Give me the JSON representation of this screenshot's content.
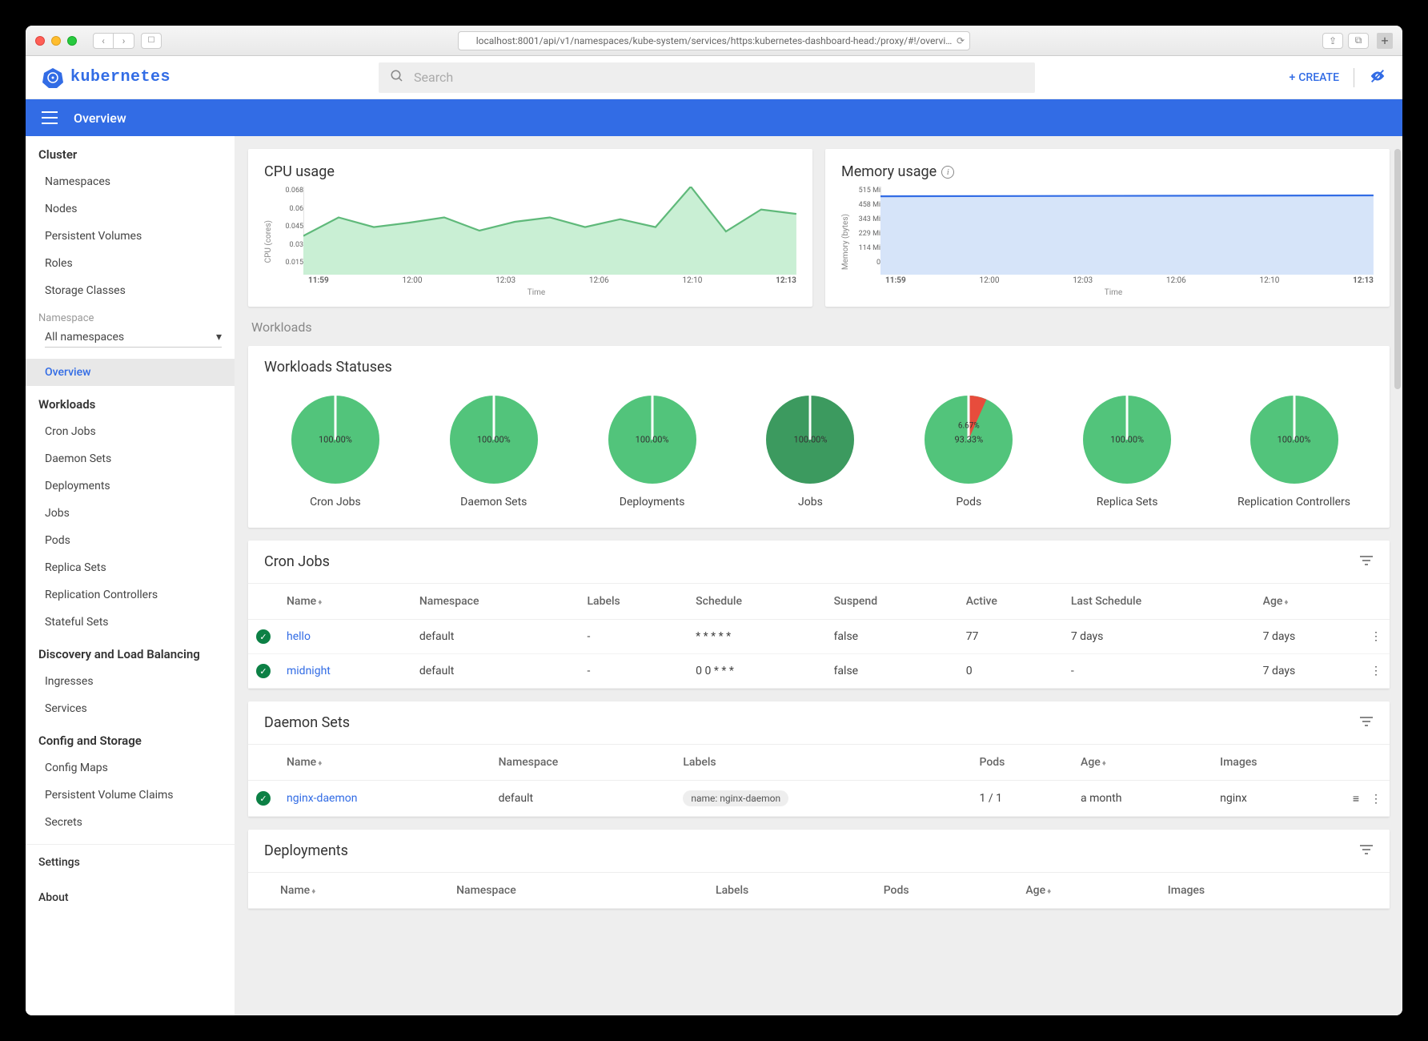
{
  "browser": {
    "url": "localhost:8001/api/v1/namespaces/kube-system/services/https:kubernetes-dashboard-head:/proxy/#!/overvi…"
  },
  "header": {
    "logo_text": "kubernetes",
    "search_placeholder": "Search",
    "create_label": "CREATE"
  },
  "bluebar": {
    "title": "Overview"
  },
  "sidebar": {
    "cluster_title": "Cluster",
    "cluster_items": [
      "Namespaces",
      "Nodes",
      "Persistent Volumes",
      "Roles",
      "Storage Classes"
    ],
    "namespace_label": "Namespace",
    "namespace_value": "All namespaces",
    "overview": "Overview",
    "workloads_title": "Workloads",
    "workloads_items": [
      "Cron Jobs",
      "Daemon Sets",
      "Deployments",
      "Jobs",
      "Pods",
      "Replica Sets",
      "Replication Controllers",
      "Stateful Sets"
    ],
    "discovery_title": "Discovery and Load Balancing",
    "discovery_items": [
      "Ingresses",
      "Services"
    ],
    "config_title": "Config and Storage",
    "config_items": [
      "Config Maps",
      "Persistent Volume Claims",
      "Secrets"
    ],
    "settings": "Settings",
    "about": "About"
  },
  "workloads_label": "Workloads",
  "cpu_chart": {
    "title": "CPU usage",
    "ylabel": "CPU (cores)",
    "xlabel": "Time"
  },
  "mem_chart": {
    "title": "Memory usage",
    "ylabel": "Memory (bytes)",
    "xlabel": "Time"
  },
  "workloads_statuses": {
    "title": "Workloads Statuses",
    "items": [
      {
        "name": "Cron Jobs",
        "pct": "100.00%",
        "green": 100,
        "red": 0,
        "dark": false
      },
      {
        "name": "Daemon Sets",
        "pct": "100.00%",
        "green": 100,
        "red": 0,
        "dark": false
      },
      {
        "name": "Deployments",
        "pct": "100.00%",
        "green": 100,
        "red": 0,
        "dark": false
      },
      {
        "name": "Jobs",
        "pct": "100.00%",
        "green": 100,
        "red": 0,
        "dark": true
      },
      {
        "name": "Pods",
        "pct": "93.33%",
        "pct2": "6.67%",
        "green": 93.33,
        "red": 6.67,
        "dark": false
      },
      {
        "name": "Replica Sets",
        "pct": "100.00%",
        "green": 100,
        "red": 0,
        "dark": false
      },
      {
        "name": "Replication Controllers",
        "pct": "100.00%",
        "green": 100,
        "red": 0,
        "dark": false
      }
    ]
  },
  "cronjobs": {
    "title": "Cron Jobs",
    "columns": [
      "Name",
      "Namespace",
      "Labels",
      "Schedule",
      "Suspend",
      "Active",
      "Last Schedule",
      "Age"
    ],
    "rows": [
      {
        "name": "hello",
        "ns": "default",
        "labels": "-",
        "schedule": "* * * * *",
        "suspend": "false",
        "active": "77",
        "last": "7 days",
        "age": "7 days"
      },
      {
        "name": "midnight",
        "ns": "default",
        "labels": "-",
        "schedule": "0 0 * * *",
        "suspend": "false",
        "active": "0",
        "last": "-",
        "age": "7 days"
      }
    ]
  },
  "daemonsets": {
    "title": "Daemon Sets",
    "columns": [
      "Name",
      "Namespace",
      "Labels",
      "Pods",
      "Age",
      "Images"
    ],
    "rows": [
      {
        "name": "nginx-daemon",
        "ns": "default",
        "labels": "name: nginx-daemon",
        "pods": "1 / 1",
        "age": "a month",
        "images": "nginx"
      }
    ]
  },
  "deployments": {
    "title": "Deployments",
    "columns": [
      "Name",
      "Namespace",
      "Labels",
      "Pods",
      "Age",
      "Images"
    ]
  },
  "chart_data": [
    {
      "type": "area",
      "title": "CPU usage",
      "xlabel": "Time",
      "ylabel": "CPU (cores)",
      "y_ticks": [
        0.068,
        0.06,
        0.045,
        0.03,
        0.015
      ],
      "x_ticks": [
        "11:59",
        "12:00",
        "12:03",
        "12:06",
        "12:10",
        "12:13"
      ],
      "ylim": [
        0,
        0.068
      ],
      "series": [
        {
          "name": "cpu",
          "color": "#5fb97a",
          "x": [
            "11:59",
            "12:00",
            "12:01",
            "12:02",
            "12:03",
            "12:04",
            "12:05",
            "12:06",
            "12:07",
            "12:08",
            "12:09",
            "12:10",
            "12:11",
            "12:12",
            "12:13"
          ],
          "values": [
            0.03,
            0.044,
            0.037,
            0.04,
            0.044,
            0.034,
            0.041,
            0.044,
            0.037,
            0.043,
            0.037,
            0.068,
            0.033,
            0.05,
            0.047
          ]
        }
      ]
    },
    {
      "type": "area",
      "title": "Memory usage",
      "xlabel": "Time",
      "ylabel": "Memory (bytes)",
      "y_ticks": [
        "515 Mi",
        "458 Mi",
        "343 Mi",
        "229 Mi",
        "114 Mi",
        "0"
      ],
      "x_ticks": [
        "11:59",
        "12:00",
        "12:03",
        "12:06",
        "12:10",
        "12:13"
      ],
      "ylim": [
        0,
        515
      ],
      "series": [
        {
          "name": "memory",
          "color": "#326ce5",
          "x": [
            "11:59",
            "12:00",
            "12:01",
            "12:02",
            "12:03",
            "12:04",
            "12:05",
            "12:06",
            "12:07",
            "12:08",
            "12:09",
            "12:10",
            "12:11",
            "12:12",
            "12:13"
          ],
          "values": [
            458,
            458,
            458,
            458,
            460,
            460,
            460,
            460,
            460,
            460,
            461,
            461,
            461,
            461,
            461
          ]
        }
      ]
    }
  ],
  "colors": {
    "green": "#52c47b",
    "dark_green": "#3c9a5f",
    "red": "#e74c3c",
    "blue": "#326ce5"
  }
}
